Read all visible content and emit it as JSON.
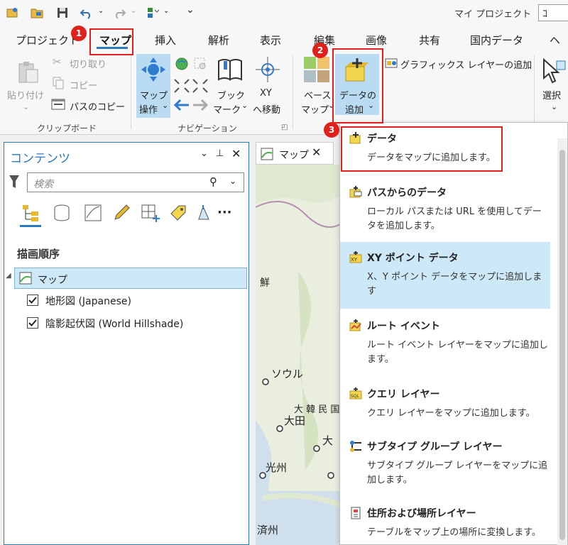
{
  "app": {
    "title": "マイ プロジェクト",
    "search_label": "ｺ"
  },
  "tabs": [
    "プロジェクト",
    "マップ",
    "挿入",
    "解析",
    "表示",
    "編集",
    "画像",
    "共有",
    "国内データ",
    "ヘル"
  ],
  "ribbon": {
    "clipboard": {
      "paste": "貼り付け",
      "cut": "切り取り",
      "copy": "コピー",
      "copy_path": "パスのコピー",
      "group": "クリップボード"
    },
    "navigation": {
      "explore_line1": "マップ",
      "explore_line2": "操作",
      "bookmarks_line1": "ブック",
      "bookmarks_line2": "マーク",
      "xy_line1": "XY",
      "xy_line2": "へ移動",
      "group": "ナビゲーション"
    },
    "layer": {
      "basemap_line1": "ベース",
      "basemap_line2": "マップ",
      "add_data_line1": "データの",
      "add_data_line2": "追加",
      "add_graphics": "グラフィックス レイヤーの追加"
    },
    "selection": {
      "select": "選択"
    }
  },
  "contents": {
    "title": "コンテンツ",
    "search_placeholder": "検索",
    "drawing_order": "描画順序",
    "map_item": "マップ",
    "layers": [
      "地形図 (Japanese)",
      "陰影起伏図 (World Hillshade)"
    ]
  },
  "map_view": {
    "tab_label": "マップ",
    "labels": [
      "鮮",
      "ソウル",
      "大 韓 民 国",
      "大田",
      "大",
      "光州",
      "済州"
    ]
  },
  "dropdown": {
    "items": [
      {
        "title": "データ",
        "desc": "データをマップに追加します。"
      },
      {
        "title": "パスからのデータ",
        "desc": "ローカル パスまたは URL を使用してデータを追加します。"
      },
      {
        "title": "XY ポイント データ",
        "desc": "X、Y ポイント データをマップに追加します"
      },
      {
        "title": "ルート イベント",
        "desc": "ルート イベント レイヤーをマップに追加します。"
      },
      {
        "title": "クエリ レイヤー",
        "desc": "クエリ レイヤーをマップに追加します。"
      },
      {
        "title": "サブタイプ グループ レイヤー",
        "desc": "サブタイプ グループ レイヤーをマップに追加します。"
      },
      {
        "title": "住所および場所レイヤー",
        "desc": "テーブルをマップ上の場所に変換します。"
      }
    ]
  },
  "callouts": [
    "1",
    "2",
    "3"
  ],
  "colors": {
    "accent": "#2a7ac0",
    "highlight": "#cde8f7",
    "callout_red": "#e0201b",
    "active_button": "#b9dcf3"
  }
}
